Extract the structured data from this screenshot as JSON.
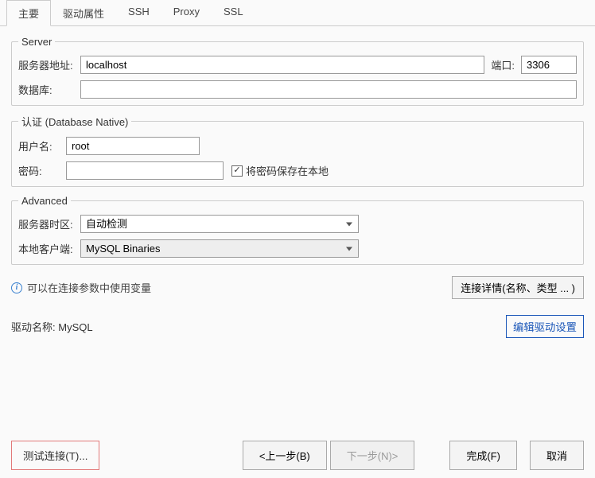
{
  "tabs": {
    "main": "主要",
    "driver_props": "驱动属性",
    "ssh": "SSH",
    "proxy": "Proxy",
    "ssl": "SSL"
  },
  "server": {
    "legend": "Server",
    "host_label": "服务器地址:",
    "host_value": "localhost",
    "port_label": "端口:",
    "port_value": "3306",
    "database_label": "数据库:",
    "database_value": ""
  },
  "auth": {
    "legend": "认证 (Database Native)",
    "username_label": "用户名:",
    "username_value": "root",
    "password_label": "密码:",
    "password_value": "",
    "save_password_label": "将密码保存在本地",
    "save_password_checked": "✓"
  },
  "advanced": {
    "legend": "Advanced",
    "timezone_label": "服务器时区:",
    "timezone_value": "自动检测",
    "local_client_label": "本地客户端:",
    "local_client_value": "MySQL Binaries"
  },
  "info": {
    "var_hint": "可以在连接参数中使用变量",
    "details_button": "连接详情(名称、类型 ... )"
  },
  "driver": {
    "name_label": "驱动名称: ",
    "name_value": "MySQL",
    "edit_button": "编辑驱动设置"
  },
  "buttons": {
    "test_connection": "测试连接(T)...",
    "back": "<上一步(B)",
    "next": "下一步(N)>",
    "finish": "完成(F)",
    "cancel": "取消"
  }
}
